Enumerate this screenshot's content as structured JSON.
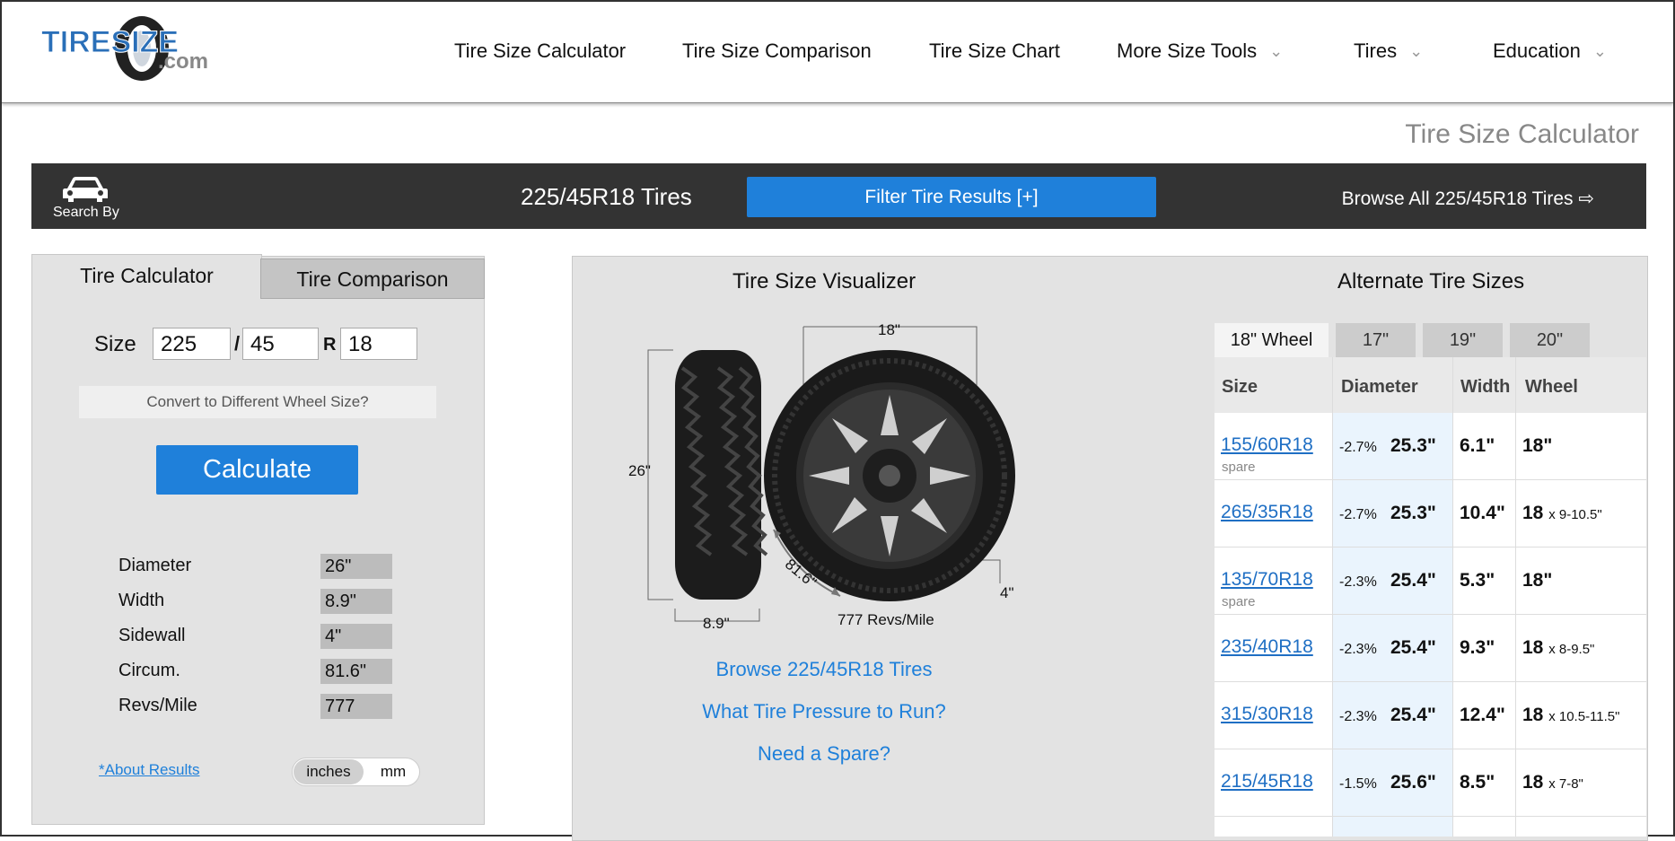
{
  "logo": {
    "main": "TIRESIZE",
    "sub": ".com"
  },
  "nav": [
    {
      "label": "Tire Size Calculator",
      "dropdown": false
    },
    {
      "label": "Tire Size Comparison",
      "dropdown": false
    },
    {
      "label": "Tire Size Chart",
      "dropdown": false
    },
    {
      "label": "More Size Tools",
      "dropdown": true
    },
    {
      "label": "Tires",
      "dropdown": true
    },
    {
      "label": "Education",
      "dropdown": true
    }
  ],
  "page_title": "Tire Size Calculator",
  "bar": {
    "search_by": "Search By",
    "title": "225/45R18 Tires",
    "filter_button": "Filter Tire Results [+]",
    "browse_all": "Browse All 225/45R18 Tires ⇨"
  },
  "calculator": {
    "tab_active": "Tire Calculator",
    "tab_inactive": "Tire Comparison",
    "size_label": "Size",
    "width": "225",
    "sep1": "/",
    "aspect": "45",
    "sep2": "R",
    "rim": "18",
    "convert": "Convert to Different Wheel Size?",
    "calculate": "Calculate",
    "results": [
      {
        "label": "Diameter",
        "value": "26\""
      },
      {
        "label": "Width",
        "value": "8.9\""
      },
      {
        "label": "Sidewall",
        "value": "4\""
      },
      {
        "label": "Circum.",
        "value": "81.6\""
      },
      {
        "label": "Revs/Mile",
        "value": "777"
      }
    ],
    "about": "*About Results",
    "unit_inches": "inches",
    "unit_mm": "mm"
  },
  "visualizer": {
    "title": "Tire Size Visualizer",
    "rim_label": "18\"",
    "height_label": "26\"",
    "width_label": "8.9\"",
    "circ_label": "81.6\"",
    "sidewall_label": "4\"",
    "revs_label": "777 Revs/Mile",
    "links": [
      "Browse 225/45R18 Tires",
      "What Tire Pressure to Run?",
      "Need a Spare?"
    ]
  },
  "alternate": {
    "title": "Alternate Tire Sizes",
    "tabs": [
      "18\" Wheel",
      "17\"",
      "19\"",
      "20\""
    ],
    "headers": [
      "Size",
      "Diameter",
      "Width",
      "Wheel"
    ],
    "rows": [
      {
        "size": "155/60R18",
        "note": "spare",
        "pct": "-2.7%",
        "diameter": "25.3\"",
        "width": "6.1\"",
        "wheel": "18\"",
        "wheel_range": ""
      },
      {
        "size": "265/35R18",
        "note": "",
        "pct": "-2.7%",
        "diameter": "25.3\"",
        "width": "10.4\"",
        "wheel": "18",
        "wheel_range": "x 9-10.5\""
      },
      {
        "size": "135/70R18",
        "note": "spare",
        "pct": "-2.3%",
        "diameter": "25.4\"",
        "width": "5.3\"",
        "wheel": "18\"",
        "wheel_range": ""
      },
      {
        "size": "235/40R18",
        "note": "",
        "pct": "-2.3%",
        "diameter": "25.4\"",
        "width": "9.3\"",
        "wheel": "18",
        "wheel_range": "x 8-9.5\""
      },
      {
        "size": "315/30R18",
        "note": "",
        "pct": "-2.3%",
        "diameter": "25.4\"",
        "width": "12.4\"",
        "wheel": "18",
        "wheel_range": "x 10.5-11.5\""
      },
      {
        "size": "215/45R18",
        "note": "",
        "pct": "-1.5%",
        "diameter": "25.6\"",
        "width": "8.5\"",
        "wheel": "18",
        "wheel_range": "x 7-8\""
      }
    ]
  },
  "colors": {
    "accent": "#1f80da",
    "dark_bar": "#333333",
    "panel": "#e3e3e3"
  }
}
